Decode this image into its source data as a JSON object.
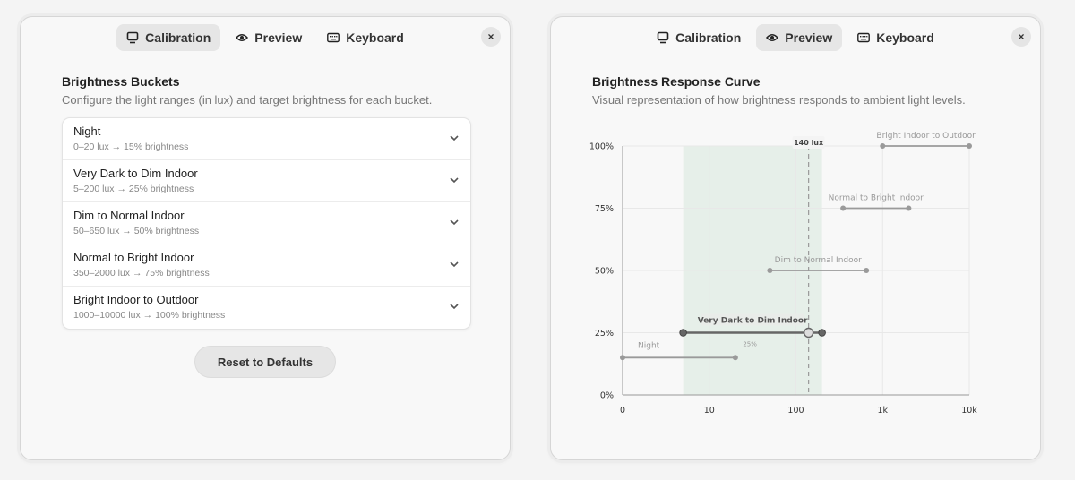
{
  "tabs": [
    {
      "label": "Calibration",
      "icon": "monitor-icon"
    },
    {
      "label": "Preview",
      "icon": "eye-icon"
    },
    {
      "label": "Keyboard",
      "icon": "keyboard-icon"
    }
  ],
  "close_label": "×",
  "calibration": {
    "title": "Brightness Buckets",
    "description": "Configure the light ranges (in lux) and target brightness for each bucket.",
    "buckets": [
      {
        "name": "Night",
        "summary": "0–20 lux → 15% brightness"
      },
      {
        "name": "Very Dark to Dim Indoor",
        "summary": "5–200 lux → 25% brightness"
      },
      {
        "name": "Dim to Normal Indoor",
        "summary": "50–650 lux → 50% brightness"
      },
      {
        "name": "Normal to Bright Indoor",
        "summary": "350–2000 lux → 75% brightness"
      },
      {
        "name": "Bright Indoor to Outdoor",
        "summary": "1000–10000 lux → 100% brightness"
      }
    ],
    "reset_label": "Reset to Defaults"
  },
  "preview": {
    "title": "Brightness Response Curve",
    "description": "Visual representation of how brightness responds to ambient light levels."
  },
  "colors": {
    "segment": "#9a9a9a",
    "active_segment": "#666666",
    "band": "#e6efe9",
    "grid": "#e8e8e8"
  },
  "chart_data": {
    "type": "line",
    "x_scale": "log",
    "x_ticks": [
      {
        "value": 1,
        "label": "0"
      },
      {
        "value": 10,
        "label": "10"
      },
      {
        "value": 100,
        "label": "100"
      },
      {
        "value": 1000,
        "label": "1k"
      },
      {
        "value": 10000,
        "label": "10k"
      }
    ],
    "y_ticks": [
      {
        "value": 0,
        "label": "0%"
      },
      {
        "value": 25,
        "label": "25%"
      },
      {
        "value": 50,
        "label": "50%"
      },
      {
        "value": 75,
        "label": "75%"
      },
      {
        "value": 100,
        "label": "100%"
      }
    ],
    "xlim": [
      1,
      10000
    ],
    "ylim": [
      0,
      100
    ],
    "grid": true,
    "current_lux": 140,
    "current_lux_label": "140 lux",
    "active_brightness_label": "25%",
    "active_band": [
      5,
      200
    ],
    "series": [
      {
        "name": "Night",
        "x": [
          1,
          20
        ],
        "y": 15,
        "active": false
      },
      {
        "name": "Very Dark to Dim Indoor",
        "x": [
          5,
          200
        ],
        "y": 25,
        "active": true
      },
      {
        "name": "Dim to Normal Indoor",
        "x": [
          50,
          650
        ],
        "y": 50,
        "active": false
      },
      {
        "name": "Normal to Bright Indoor",
        "x": [
          350,
          2000
        ],
        "y": 75,
        "active": false
      },
      {
        "name": "Bright Indoor to Outdoor",
        "x": [
          1000,
          10000
        ],
        "y": 100,
        "active": false
      }
    ]
  }
}
